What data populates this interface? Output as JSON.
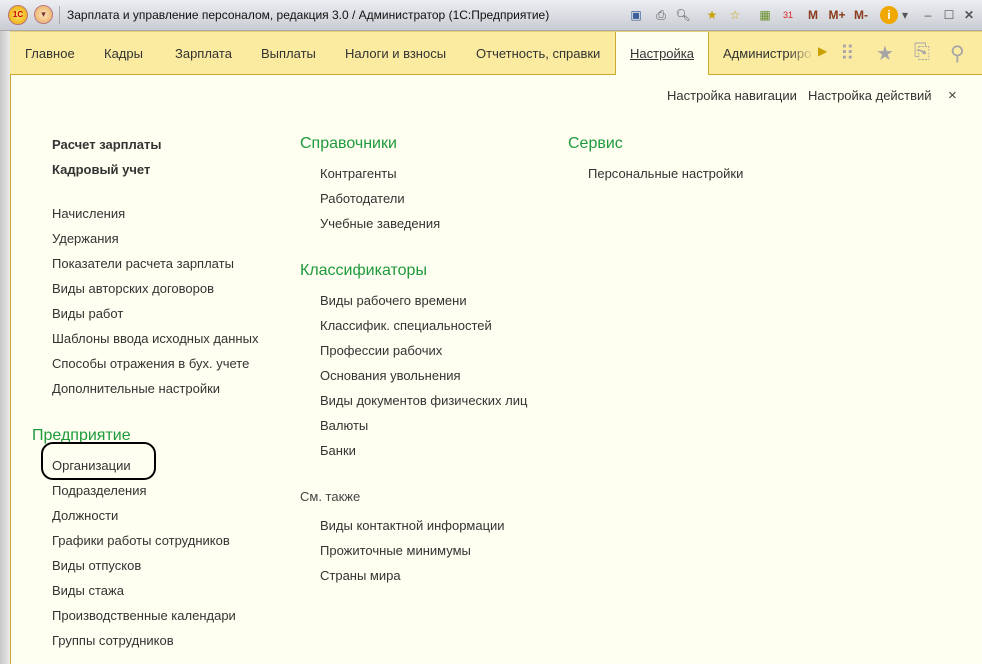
{
  "window": {
    "title": "Зарплата и управление персоналом, редакция 3.0 / Администратор  (1С:Предприятие)",
    "logo": "1С",
    "toolbar": [
      "save-icon",
      "print-icon",
      "preview-icon",
      "add-favorite-icon",
      "favorites-icon",
      "calculator-icon",
      "calendar-icon"
    ],
    "calendar_day": "31",
    "m": "M",
    "mplus": "M+",
    "mminus": "M-",
    "info": "i"
  },
  "nav": {
    "tabs": [
      "Главное",
      "Кадры",
      "Зарплата",
      "Выплаты",
      "Налоги и взносы",
      "Отчетность, справки",
      "Настройка",
      "Администриро"
    ],
    "active": "Настройка"
  },
  "panel": {
    "nav_settings": "Настройка навигации",
    "action_settings": "Настройка действий",
    "close": "×"
  },
  "col1": {
    "top": [
      "Расчет зарплаты",
      "Кадровый учет"
    ],
    "items": [
      "Начисления",
      "Удержания",
      "Показатели расчета зарплаты",
      "Виды авторских договоров",
      "Виды работ",
      "Шаблоны ввода исходных данных",
      "Способы отражения в бух. учете",
      "Дополнительные настройки"
    ],
    "section": "Предприятие",
    "section_items": [
      "Организации",
      "Подразделения",
      "Должности",
      "Графики работы сотрудников",
      "Виды отпусков",
      "Виды стажа",
      "Производственные календари",
      "Группы сотрудников"
    ]
  },
  "col2": {
    "s1": "Справочники",
    "s1_items": [
      "Контрагенты",
      "Работодатели",
      "Учебные заведения"
    ],
    "s2": "Классификаторы",
    "s2_items": [
      "Виды рабочего времени",
      "Классифик. специальностей",
      "Профессии рабочих",
      "Основания увольнения",
      "Виды документов физических лиц",
      "Валюты",
      "Банки"
    ],
    "s3": "См. также",
    "s3_items": [
      "Виды контактной информации",
      "Прожиточные минимумы",
      "Страны мира"
    ]
  },
  "col3": {
    "s1": "Сервис",
    "s1_items": [
      "Персональные настройки"
    ]
  }
}
